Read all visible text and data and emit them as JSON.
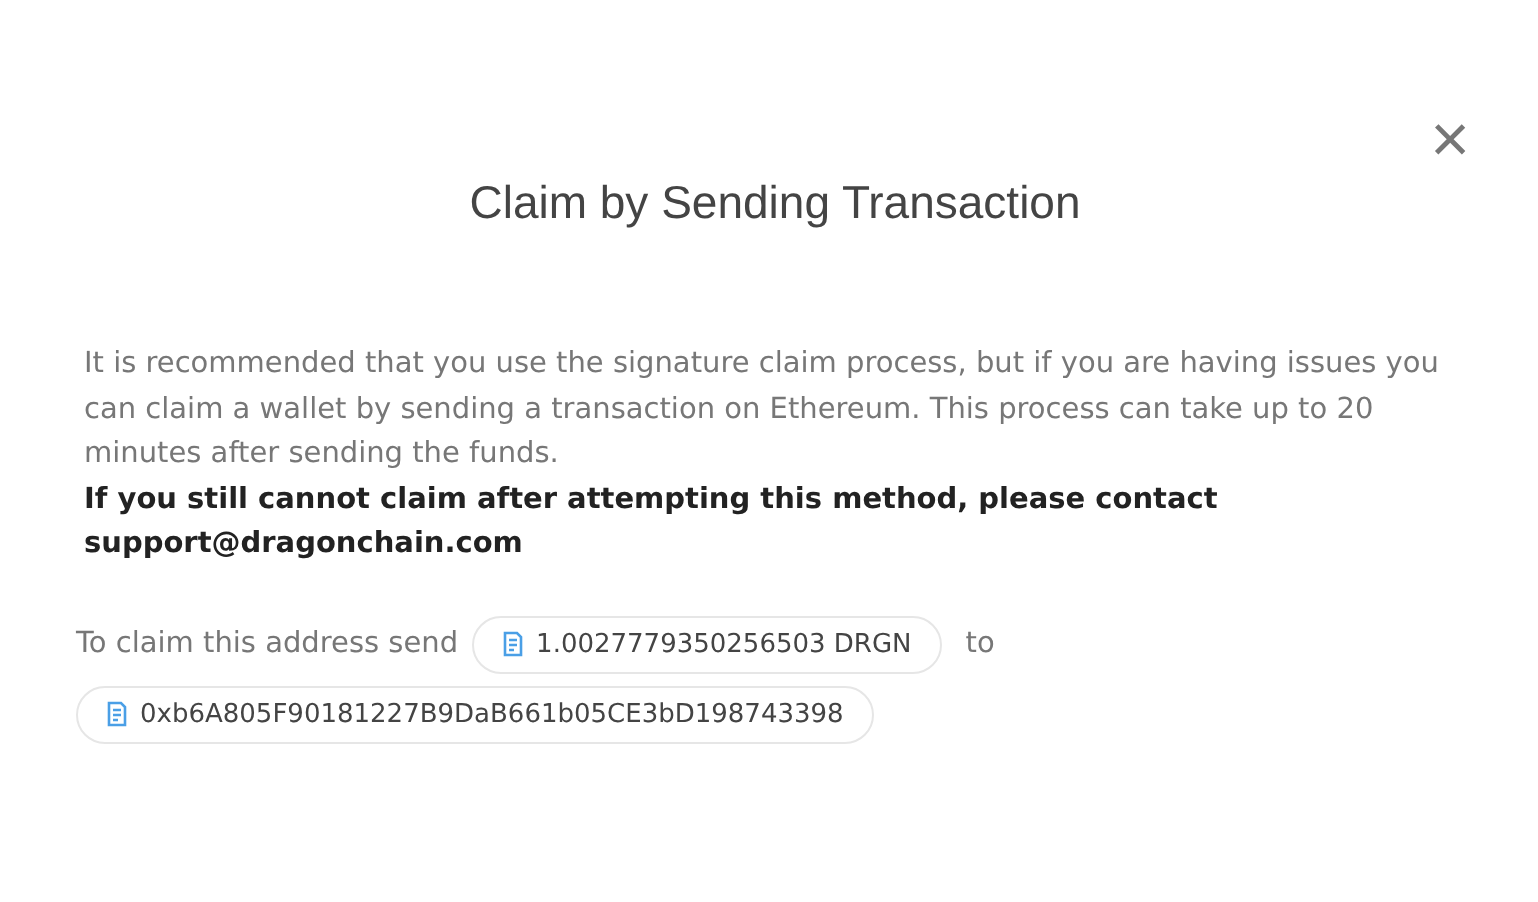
{
  "dialog": {
    "title": "Claim by Sending Transaction",
    "close": "×",
    "description": "It is recommended that you use the signature claim process, but if you are having issues you can claim a wallet by sending a transaction on Ethereum. This process can take up to 20 minutes after sending the funds.",
    "warning": "If you still cannot claim after attempting this method, please contact support@dragonchain.com",
    "instruction": {
      "prefix": "To claim this address send",
      "amount": "1.0027779350256503 DRGN",
      "connector": "to",
      "address": "0xb6A805F90181227B9DaB661b05CE3bD198743398"
    }
  }
}
